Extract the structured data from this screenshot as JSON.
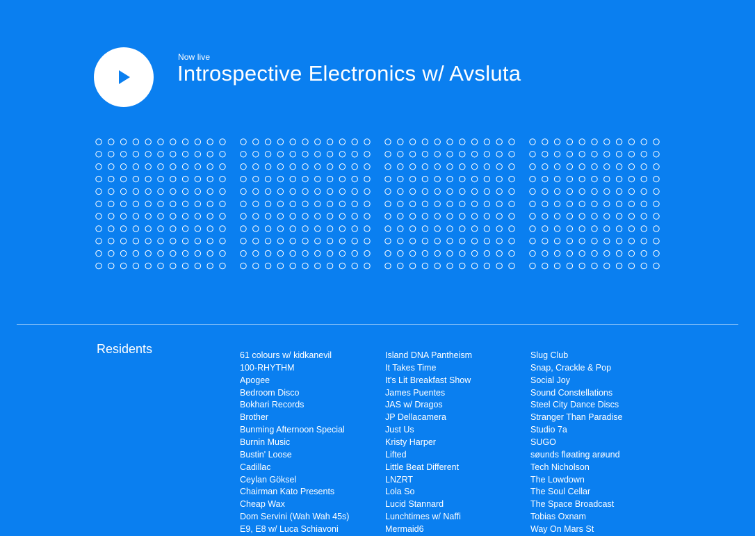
{
  "now_playing": {
    "label": "Now live",
    "title": "Introspective Electronics w/ Avsluta"
  },
  "play_icon": "play-icon",
  "visualizer": {
    "groups": 4,
    "rows": 11,
    "cols_per_group": 11
  },
  "residents": {
    "heading": "Residents",
    "columns": [
      [
        "61 colours w/ kidkanevil",
        "100-RHYTHM",
        "Apogee",
        "Bedroom Disco",
        "Bokhari Records",
        "Brother",
        "Bunming Afternoon Special",
        "Burnin Music",
        "Bustin' Loose",
        "Cadillac",
        "Ceylan Göksel",
        "Chairman Kato Presents",
        "Cheap Wax",
        "Dom Servini (Wah Wah 45s)",
        "E9, E8 w/ Luca Schiavoni"
      ],
      [
        "Island DNA Pantheism",
        "It Takes Time",
        "It's Lit Breakfast Show",
        "James Puentes",
        "JAS w/ Dragos",
        "JP Dellacamera",
        "Just Us",
        "Kristy Harper",
        "Lifted",
        "Little Beat Different",
        "LNZRT",
        "Lola So",
        "Lucid Stannard",
        "Lunchtimes w/ Naffi",
        "Mermaid6"
      ],
      [
        "Slug Club",
        "Snap, Crackle & Pop",
        "Social Joy",
        "Sound Constellations",
        "Steel City Dance Discs",
        "Stranger Than Paradise",
        "Studio 7a",
        "SUGO",
        "søunds fløating arøund",
        "Tech Nicholson",
        "The Lowdown",
        "The Soul Cellar",
        "The Space Broadcast",
        "Tobias Oxnam",
        "Way On Mars St"
      ]
    ]
  },
  "colors": {
    "background": "#0a7ff0",
    "foreground": "#ffffff"
  }
}
